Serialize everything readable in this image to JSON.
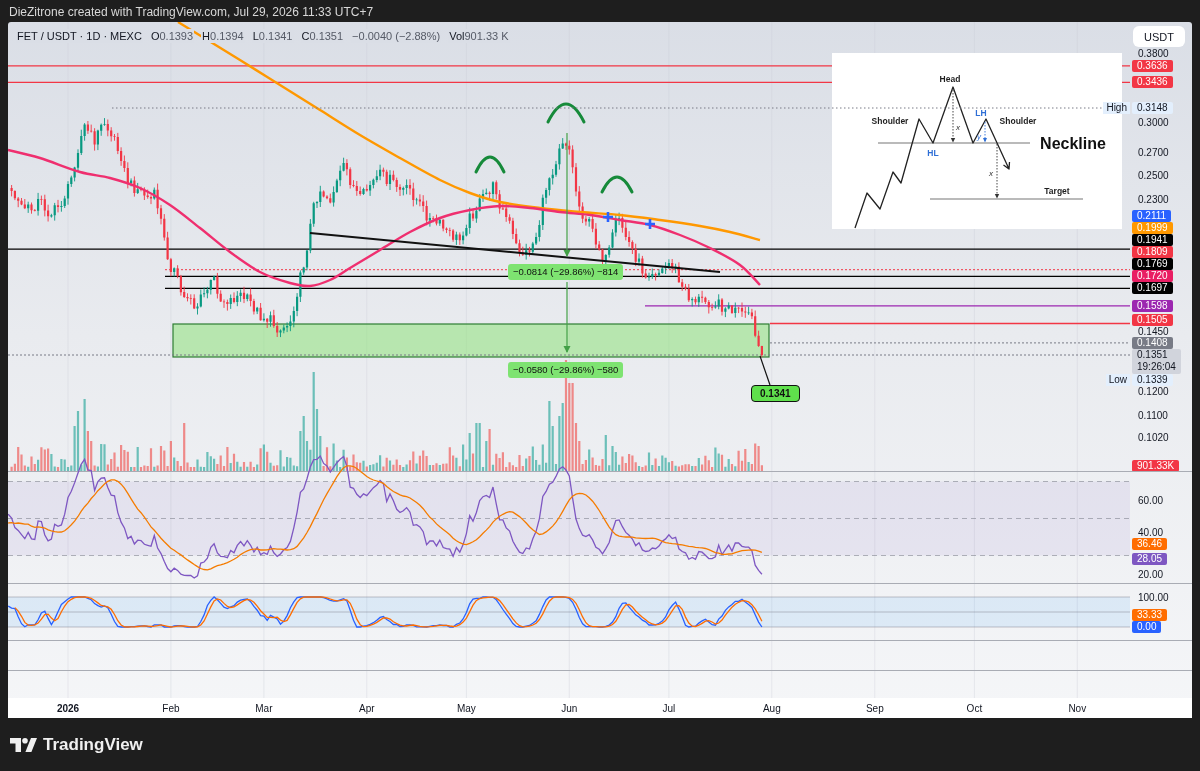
{
  "caption": "DieZitrone created with TradingView.com, Jul 29, 2026 11:33 UTC+7",
  "legend": {
    "title": "FET / USDT · 1D · MEXC",
    "values": [
      {
        "label": "O",
        "value": "0.1393"
      },
      {
        "label": "H",
        "value": "0.1394"
      },
      {
        "label": "L",
        "value": "0.1341"
      },
      {
        "label": "C",
        "value": "0.1351"
      }
    ],
    "change": "−0.0040 (−2.88%)",
    "volume_label": "Vol",
    "volume": "901.33 K"
  },
  "currency_button": "USDT",
  "price_axis": {
    "ticks": [
      "0.3800",
      "0.3000",
      "0.2700",
      "0.2500",
      "0.2300",
      "0.1450",
      "0.1200",
      "0.1100",
      "0.1020"
    ],
    "tags": [
      {
        "kind": "level",
        "text": "0.3636",
        "color": "#f23645"
      },
      {
        "kind": "level",
        "text": "0.3436",
        "color": "#f23645"
      },
      {
        "kind": "extreme",
        "label": "High",
        "text": "0.3148"
      },
      {
        "kind": "level",
        "text": "0.2111",
        "color": "#2962ff"
      },
      {
        "kind": "level",
        "text": "0.1999",
        "color": "#ff9800"
      },
      {
        "kind": "level",
        "text": "0.1941",
        "color": "#000000"
      },
      {
        "kind": "level",
        "text": "0.1809",
        "color": "#f23645"
      },
      {
        "kind": "level",
        "text": "0.1769",
        "color": "#000000"
      },
      {
        "kind": "level",
        "text": "0.1720",
        "color": "#e91e63"
      },
      {
        "kind": "level",
        "text": "0.1697",
        "color": "#000000"
      },
      {
        "kind": "level",
        "text": "0.1598",
        "color": "#9c27b0"
      },
      {
        "kind": "level",
        "text": "0.1505",
        "color": "#f23645"
      },
      {
        "kind": "level",
        "text": "0.1408",
        "color": "#787b86"
      },
      {
        "kind": "last",
        "text": "0.1351",
        "countdown": "19:26:04"
      },
      {
        "kind": "extreme",
        "label": "Low",
        "text": "0.1339"
      }
    ],
    "volume_tag": {
      "text": "901.33K",
      "color": "#f23645"
    }
  },
  "annotations": [
    {
      "kind": "measure",
      "text": "−0.0814 (−29.86%) −814"
    },
    {
      "kind": "measure",
      "text": "−0.0580 (−29.86%) −580"
    },
    {
      "kind": "callout",
      "text": "0.1341"
    }
  ],
  "inset": {
    "labels": [
      "Head",
      "Shoulder",
      "LH",
      "Shoulder",
      "Neckline",
      "HL",
      "x",
      "y",
      "x",
      "Target"
    ]
  },
  "rsi_axis": {
    "ticks": [
      "60.00",
      "40.00",
      "20.00"
    ],
    "tags": [
      {
        "text": "36.46",
        "color": "#ff6d00"
      },
      {
        "text": "28.05",
        "color": "#7e57c2"
      }
    ]
  },
  "stoch_axis": {
    "ticks": [
      "100.00"
    ],
    "tags": [
      {
        "text": "33.33",
        "color": "#ff6d00"
      },
      {
        "text": "0.00",
        "color": "#2962ff"
      }
    ]
  },
  "time_axis": [
    {
      "kind": "year",
      "text": "2026"
    },
    {
      "kind": "month",
      "text": "Feb"
    },
    {
      "kind": "month",
      "text": "Mar"
    },
    {
      "kind": "month",
      "text": "Apr"
    },
    {
      "kind": "month",
      "text": "May"
    },
    {
      "kind": "month",
      "text": "Jun"
    },
    {
      "kind": "month",
      "text": "Jul"
    },
    {
      "kind": "month",
      "text": "Aug"
    },
    {
      "kind": "month",
      "text": "Sep"
    },
    {
      "kind": "month",
      "text": "Oct"
    },
    {
      "kind": "month",
      "text": "Nov"
    }
  ],
  "brand": "TradingView"
}
